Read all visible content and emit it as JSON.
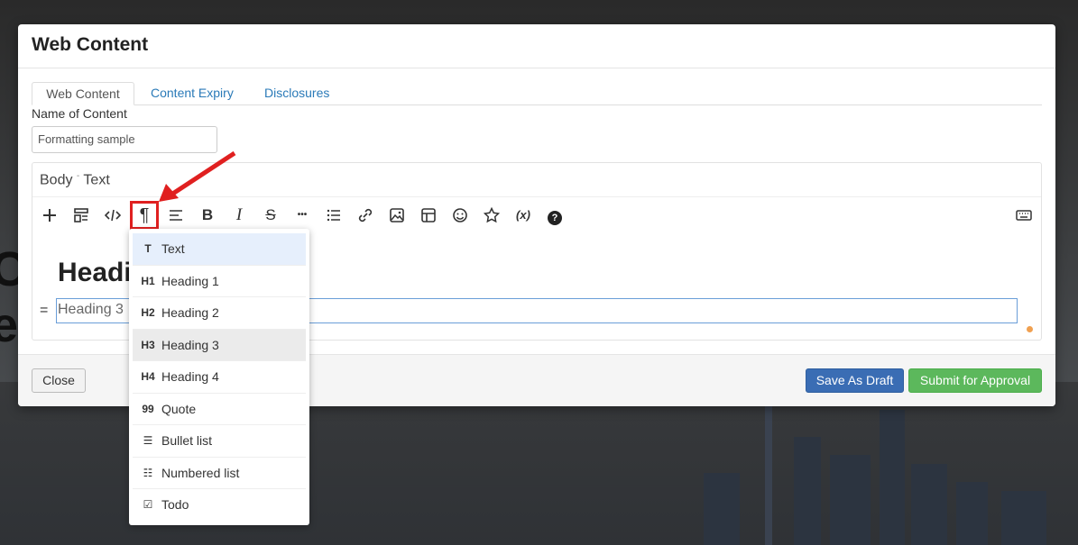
{
  "modal": {
    "title": "Web Content"
  },
  "tabs": [
    {
      "label": "Web Content",
      "active": true
    },
    {
      "label": "Content Expiry",
      "active": false
    },
    {
      "label": "Disclosures",
      "active": false
    }
  ],
  "name_field": {
    "label": "Name of Content",
    "value": "Formatting sample"
  },
  "editor": {
    "label_left": "Body",
    "label_sep": "-",
    "label_right": "Text",
    "heading_text": "Headi",
    "current_line": "Heading 3",
    "drag_glyph": "="
  },
  "toolbar": {
    "buttons": [
      "plus-icon",
      "block-icon",
      "code-icon",
      "paragraph-icon",
      "align-icon",
      "bold-icon",
      "italic-icon",
      "strikethrough-icon",
      "more-icon",
      "list-icon",
      "link-icon",
      "image-icon",
      "table-icon",
      "emoji-icon",
      "star-icon",
      "variable-icon",
      "help-icon",
      "keyboard-icon"
    ],
    "paragraph_glyph": "¶",
    "bold_glyph": "B",
    "italic_glyph": "I",
    "strike_glyph": "S",
    "more_glyph": "•••",
    "variable_glyph": "(x)",
    "help_glyph": "?"
  },
  "dropdown": {
    "items": [
      {
        "icon": "T",
        "label": "Text"
      },
      {
        "icon": "H1",
        "label": "Heading 1"
      },
      {
        "icon": "H2",
        "label": "Heading 2"
      },
      {
        "icon": "H3",
        "label": "Heading 3"
      },
      {
        "icon": "H4",
        "label": "Heading 4"
      },
      {
        "icon": "99",
        "label": "Quote"
      },
      {
        "icon": "☰",
        "label": "Bullet list"
      },
      {
        "icon": "☷",
        "label": "Numbered list"
      },
      {
        "icon": "☑",
        "label": "Todo"
      }
    ]
  },
  "footer": {
    "close_label": "Close",
    "draft_label": "Save As Draft",
    "submit_label": "Submit for Approval"
  },
  "background": {
    "text_line1": "C",
    "text_line2": "e"
  },
  "colors": {
    "accent_red": "#e02020",
    "primary_blue": "#3a6db4",
    "success_green": "#5cb85c",
    "link_blue": "#2a7ab8"
  }
}
